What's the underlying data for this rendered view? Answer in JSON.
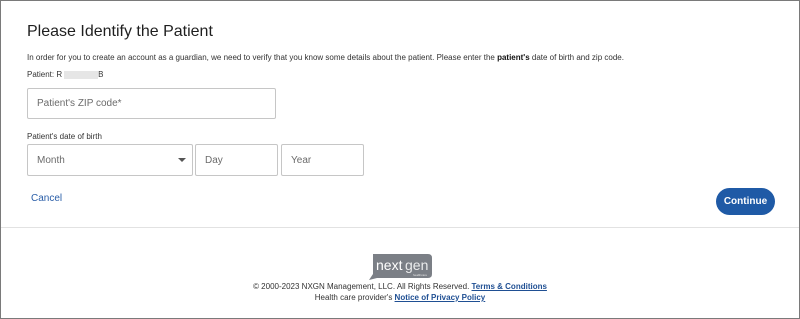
{
  "form": {
    "title": "Please Identify the Patient",
    "intro_before": "In order for you to create an account as a guardian, we need to verify that you know some details about the patient. Please enter the ",
    "intro_bold": "patient's",
    "intro_after": " date of birth and zip code.",
    "patient_label": "Patient: ",
    "patient_name_start": "R",
    "patient_name_end": "B",
    "zip_placeholder": "Patient's ZIP code*",
    "dob_label": "Patient's date of birth",
    "month_placeholder": "Month",
    "day_placeholder": "Day",
    "year_placeholder": "Year",
    "cancel_label": "Cancel",
    "continue_label": "Continue",
    "accent_color": "#1f5aa6"
  },
  "footer": {
    "logo_text_part1": "next",
    "logo_text_part2": "gen",
    "logo_subtext": "healthcare",
    "copyright": "© 2000-2023 NXGN Management, LLC. All Rights Reserved. ",
    "terms_link": "Terms & Conditions",
    "provider_prefix": "Health care provider's ",
    "privacy_link": "Notice of Privacy Policy"
  }
}
